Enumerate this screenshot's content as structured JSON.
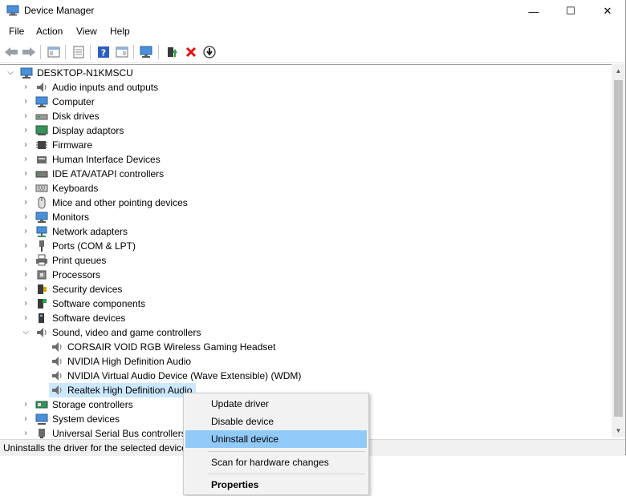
{
  "window": {
    "title": "Device Manager",
    "minimize": "—",
    "maximize": "☐",
    "close": "✕"
  },
  "menu": [
    "File",
    "Action",
    "View",
    "Help"
  ],
  "tree": {
    "root": "DESKTOP-N1KMSCU",
    "categories": [
      {
        "label": "Audio inputs and outputs",
        "icon": "speaker-icon"
      },
      {
        "label": "Computer",
        "icon": "computer-icon"
      },
      {
        "label": "Disk drives",
        "icon": "disk-drive-icon"
      },
      {
        "label": "Display adaptors",
        "icon": "display-adapter-icon"
      },
      {
        "label": "Firmware",
        "icon": "chip-icon"
      },
      {
        "label": "Human Interface Devices",
        "icon": "hid-icon"
      },
      {
        "label": "IDE ATA/ATAPI controllers",
        "icon": "ide-controller-icon"
      },
      {
        "label": "Keyboards",
        "icon": "keyboard-icon"
      },
      {
        "label": "Mice and other pointing devices",
        "icon": "mouse-icon"
      },
      {
        "label": "Monitors",
        "icon": "monitor-icon"
      },
      {
        "label": "Network adapters",
        "icon": "network-adapter-icon"
      },
      {
        "label": "Ports (COM & LPT)",
        "icon": "port-icon"
      },
      {
        "label": "Print queues",
        "icon": "printer-icon"
      },
      {
        "label": "Processors",
        "icon": "processor-icon"
      },
      {
        "label": "Security devices",
        "icon": "security-device-icon"
      },
      {
        "label": "Software components",
        "icon": "software-component-icon"
      },
      {
        "label": "Software devices",
        "icon": "software-device-icon"
      },
      {
        "label": "Sound, video and game controllers",
        "icon": "speaker-icon",
        "expanded": true
      }
    ],
    "sound_children": [
      "CORSAIR VOID RGB Wireless Gaming Headset",
      "NVIDIA High Definition Audio",
      "NVIDIA Virtual Audio Device (Wave Extensible) (WDM)",
      "Realtek High Definition Audio"
    ],
    "after": [
      {
        "label": "Storage controllers",
        "icon": "storage-controller-icon"
      },
      {
        "label": "System devices",
        "icon": "computer-icon"
      },
      {
        "label": "Universal Serial Bus controllers",
        "icon": "usb-icon"
      }
    ]
  },
  "status": "Uninstalls the driver for the selected device.",
  "context_menu": {
    "update": "Update driver",
    "disable": "Disable device",
    "uninstall": "Uninstall device",
    "scan": "Scan for hardware changes",
    "properties": "Properties"
  },
  "colors": {
    "selection": "#cce8ff",
    "menu_highlight": "#91c9f7",
    "accent": "#0078d7"
  }
}
